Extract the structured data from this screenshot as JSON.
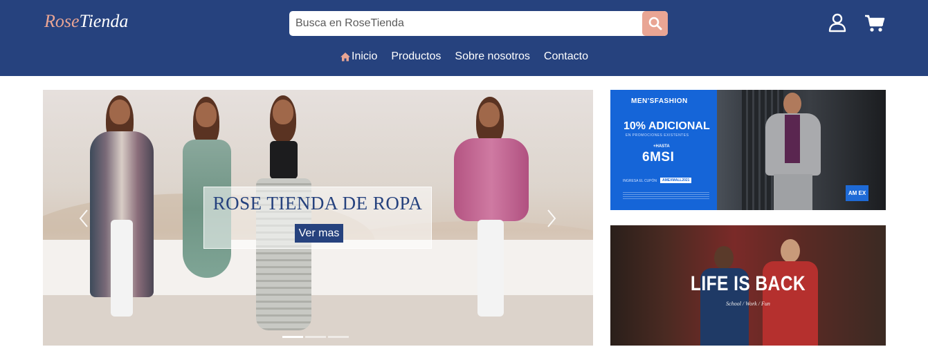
{
  "header": {
    "logo_rose": "Rose",
    "logo_tienda": "Tienda",
    "search_placeholder": "Busca en RoseTienda",
    "nav": [
      {
        "label": "Inicio",
        "icon": "home-icon"
      },
      {
        "label": "Productos"
      },
      {
        "label": "Sobre nosotros"
      },
      {
        "label": "Contacto"
      }
    ],
    "icons": {
      "user": "user-icon",
      "cart": "cart-icon",
      "search": "search-icon"
    }
  },
  "carousel": {
    "caption_title": "ROSE TIENDA DE ROPA",
    "caption_button": "Ver mas",
    "slide_count": 3,
    "active_slide": 1
  },
  "banners": {
    "mens": {
      "brand": "MEN'SFASHION",
      "headline": "10% ADICIONAL",
      "subline": "EN PROMOCIONES EXISTENTES",
      "hasta": "+HASTA",
      "msi": "6MSI",
      "code_label": "INGRESA EL CUPÓN",
      "code": "AMEXMALL2021",
      "card": "AM EX"
    },
    "life": {
      "title": "LIFE IS BACK",
      "subtitle": "School / Work / Fun"
    }
  },
  "colors": {
    "header_bg": "#26427e",
    "accent": "#e9a594",
    "white": "#ffffff"
  }
}
